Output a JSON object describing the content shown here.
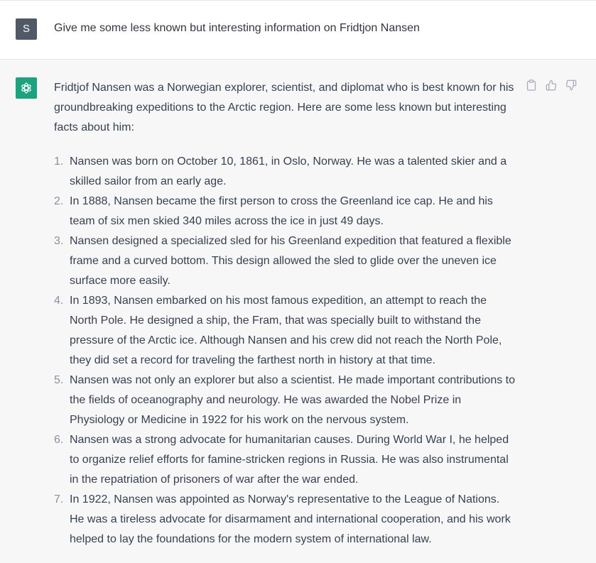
{
  "user": {
    "avatar_letter": "S",
    "message": "Give me some less known but interesting information on Fridtjon Nansen"
  },
  "assistant": {
    "intro": "Fridtjof Nansen was a Norwegian explorer, scientist, and diplomat who is best known for his groundbreaking expeditions to the Arctic region. Here are some less known but interesting facts about him:",
    "facts": [
      {
        "num": "1.",
        "text": "Nansen was born on October 10, 1861, in Oslo, Norway. He was a talented skier and a skilled sailor from an early age."
      },
      {
        "num": "2.",
        "text": "In 1888, Nansen became the first person to cross the Greenland ice cap. He and his team of six men skied 340 miles across the ice in just 49 days."
      },
      {
        "num": "3.",
        "text": "Nansen designed a specialized sled for his Greenland expedition that featured a flexible frame and a curved bottom. This design allowed the sled to glide over the uneven ice surface more easily."
      },
      {
        "num": "4.",
        "text": "In 1893, Nansen embarked on his most famous expedition, an attempt to reach the North Pole. He designed a ship, the Fram, that was specially built to withstand the pressure of the Arctic ice. Although Nansen and his crew did not reach the North Pole, they did set a record for traveling the farthest north in history at that time."
      },
      {
        "num": "5.",
        "text": "Nansen was not only an explorer but also a scientist. He made important contributions to the fields of oceanography and neurology. He was awarded the Nobel Prize in Physiology or Medicine in 1922 for his work on the nervous system."
      },
      {
        "num": "6.",
        "text": "Nansen was a strong advocate for humanitarian causes. During World War I, he helped to organize relief efforts for famine-stricken regions in Russia. He was also instrumental in the repatriation of prisoners of war after the war ended."
      },
      {
        "num": "7.",
        "text": "In 1922, Nansen was appointed as Norway's representative to the League of Nations. He was a tireless advocate for disarmament and international cooperation, and his work helped to lay the foundations for the modern system of international law."
      }
    ],
    "icons": {
      "avatar": "openai-logo-icon",
      "copy": "clipboard-icon",
      "like": "thumbs-up-icon",
      "dislike": "thumbs-down-icon"
    }
  },
  "colors": {
    "assistant_bg": "#f7f7f8",
    "bot_avatar": "#19a37f",
    "user_avatar": "#4f5a66"
  }
}
